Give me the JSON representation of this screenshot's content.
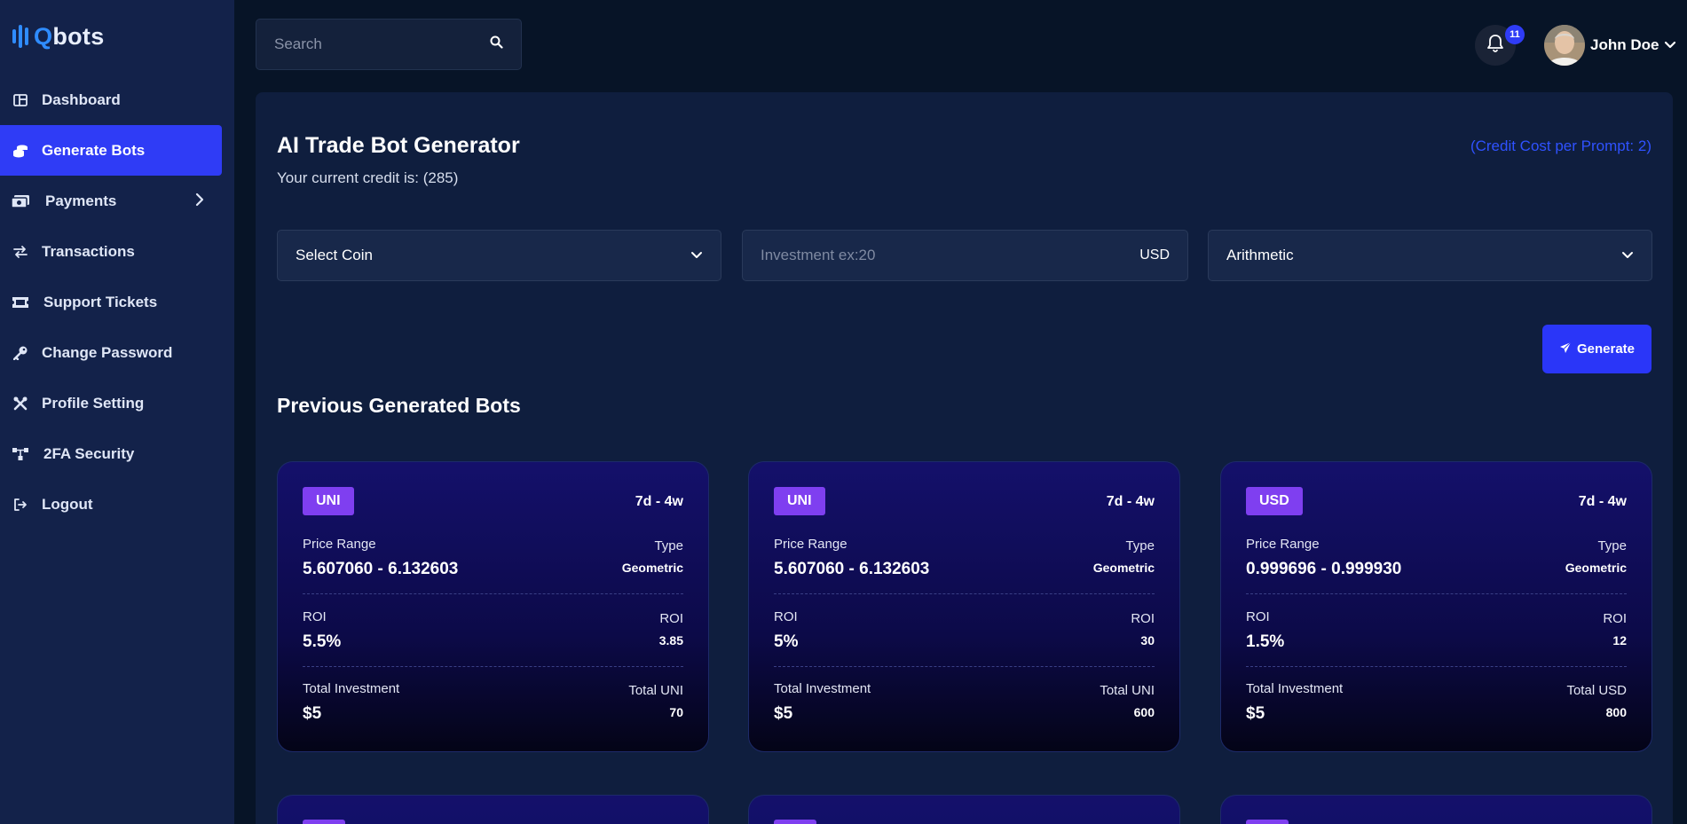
{
  "brand": {
    "prefix": "Q",
    "rest": "bots"
  },
  "sidebar": {
    "items": [
      {
        "label": "Dashboard",
        "icon": "dashboard-icon"
      },
      {
        "label": "Generate Bots",
        "icon": "coins-icon",
        "active": true
      },
      {
        "label": "Payments",
        "icon": "money-icon",
        "has_submenu": true
      },
      {
        "label": "Transactions",
        "icon": "exchange-icon"
      },
      {
        "label": "Support Tickets",
        "icon": "ticket-icon"
      },
      {
        "label": "Change Password",
        "icon": "key-icon"
      },
      {
        "label": "Profile Setting",
        "icon": "tools-icon"
      },
      {
        "label": "2FA Security",
        "icon": "network-icon"
      },
      {
        "label": "Logout",
        "icon": "logout-icon"
      }
    ]
  },
  "header": {
    "search_placeholder": "Search",
    "notification_count": "11",
    "user_name": "John Doe"
  },
  "main": {
    "title": "AI Trade Bot Generator",
    "credit_text": "Your current credit is: (285)",
    "credit_cost": "(Credit Cost per Prompt: 2)",
    "coin_select": "Select Coin",
    "investment_placeholder": "Investment ex:20",
    "investment_suffix": "USD",
    "strategy_select": "Arithmetic",
    "generate_label": "Generate",
    "previous_title": "Previous Generated Bots"
  },
  "bots": [
    {
      "coin": "UNI",
      "period": "7d - 4w",
      "price_range_label": "Price Range",
      "price_range": "5.607060 - 6.132603",
      "type_label": "Type",
      "type": "Geometric",
      "roi_label": "ROI",
      "roi": "5.5%",
      "roi_right_label": "ROI",
      "roi_right": "3.85",
      "investment_label": "Total Investment",
      "investment": "$5",
      "total_label": "Total UNI",
      "total": "70"
    },
    {
      "coin": "UNI",
      "period": "7d - 4w",
      "price_range_label": "Price Range",
      "price_range": "5.607060 - 6.132603",
      "type_label": "Type",
      "type": "Geometric",
      "roi_label": "ROI",
      "roi": "5%",
      "roi_right_label": "ROI",
      "roi_right": "30",
      "investment_label": "Total Investment",
      "investment": "$5",
      "total_label": "Total UNI",
      "total": "600"
    },
    {
      "coin": "USD",
      "period": "7d - 4w",
      "price_range_label": "Price Range",
      "price_range": "0.999696 - 0.999930",
      "type_label": "Type",
      "type": "Geometric",
      "roi_label": "ROI",
      "roi": "1.5%",
      "roi_right_label": "ROI",
      "roi_right": "12",
      "investment_label": "Total Investment",
      "investment": "$5",
      "total_label": "Total USD",
      "total": "800"
    }
  ],
  "colors": {
    "accent": "#2f3cf6",
    "badge_purple": "#7f3ff0",
    "sidebar_bg": "#13224a",
    "page_bg": "#071427"
  }
}
